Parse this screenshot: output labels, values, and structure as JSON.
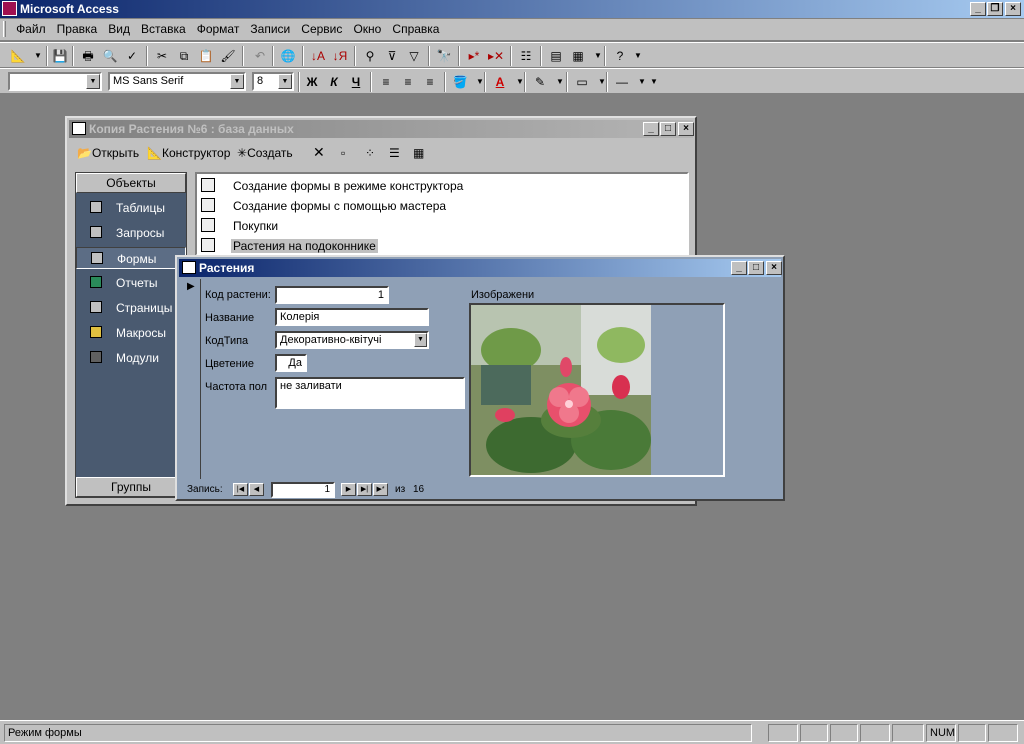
{
  "app": {
    "title": "Microsoft Access"
  },
  "menu": [
    "Файл",
    "Правка",
    "Вид",
    "Вставка",
    "Формат",
    "Записи",
    "Сервис",
    "Окно",
    "Справка"
  ],
  "format_toolbar": {
    "object_combo": "",
    "font_combo": "MS Sans Serif",
    "size_combo": "8",
    "bold": "Ж",
    "italic": "К",
    "underline": "Ч",
    "font_color_glyph": "A"
  },
  "db_window": {
    "title": "Копия Растения №6 : база данных",
    "toolbar": {
      "open": "Открыть",
      "design": "Конструктор",
      "create": "Создать"
    },
    "objects_header": "Объекты",
    "groups_header": "Группы",
    "objects": [
      "Таблицы",
      "Запросы",
      "Формы",
      "Отчеты",
      "Страницы",
      "Макросы",
      "Модули"
    ],
    "selected_object": "Формы",
    "list": [
      "Создание формы в режиме конструктора",
      "Создание формы с помощью мастера",
      "Покупки",
      "Растения на подоконнике"
    ],
    "selected_list_item": "Растения на подоконнике"
  },
  "form_window": {
    "title": "Растения",
    "fields": {
      "code_label": "Код растени:",
      "code_value": "1",
      "name_label": "Название",
      "name_value": "Колерія",
      "type_label": "КодТипа",
      "type_value": "Декоративно-квітучі",
      "bloom_label": "Цветение",
      "bloom_value": "Да",
      "water_label": "Частота пол",
      "water_value": "не заливати",
      "image_label": "Изображени"
    },
    "navigation": {
      "label": "Запись:",
      "current": "1",
      "of_label": "из",
      "total": "16"
    }
  },
  "statusbar": {
    "mode": "Режим формы",
    "num": "NUM"
  },
  "colors": {
    "desktop": "#808080",
    "form_bg": "#8fa0b6",
    "objects_bar": "#4a5a70",
    "title_active": "#0a246a"
  }
}
